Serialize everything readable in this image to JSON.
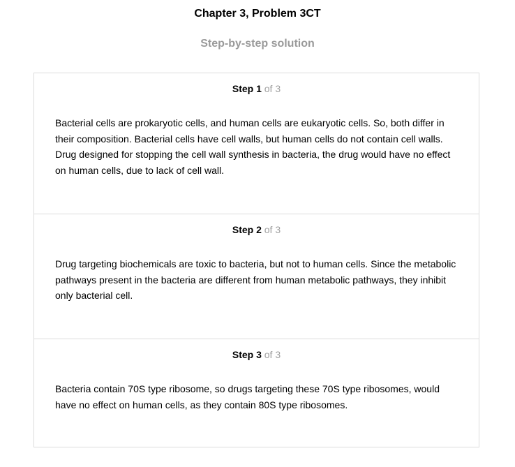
{
  "header": {
    "chapter_title": "Chapter 3, Problem 3CT",
    "subtitle": "Step-by-step solution"
  },
  "steps": [
    {
      "label": "Step 1",
      "of": "of 3",
      "text": "Bacterial cells are prokaryotic cells, and human cells are eukaryotic cells. So, both differ in their composition. Bacterial cells have cell walls, but human cells do not contain cell walls. Drug designed for stopping the cell wall synthesis in bacteria, the drug would have no effect on human cells, due to lack of cell wall."
    },
    {
      "label": "Step 2",
      "of": "of 3",
      "text": "Drug targeting biochemicals are toxic to bacteria, but not to human cells. Since the metabolic pathways present in the bacteria are different from human metabolic pathways, they inhibit only bacterial cell."
    },
    {
      "label": "Step 3",
      "of": "of 3",
      "text": "Bacteria contain 70S type ribosome, so drugs targeting these 70S type ribosomes, would have no effect on human cells, as they contain 80S type ribosomes."
    }
  ]
}
